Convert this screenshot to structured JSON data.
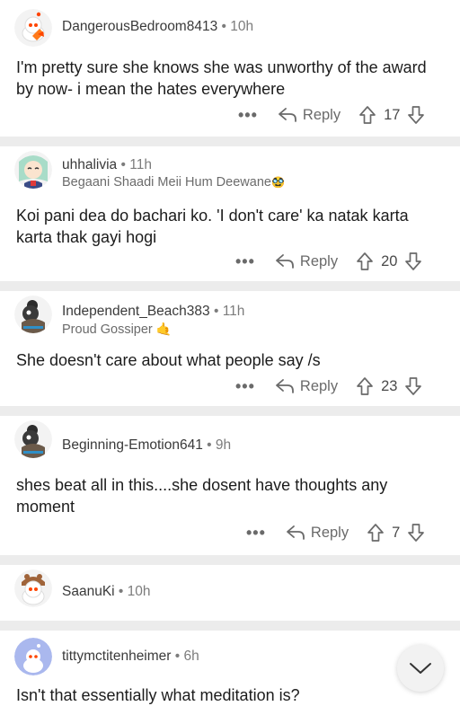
{
  "comments": [
    {
      "username": "DangerousBedroom8413",
      "time": "10h",
      "body": "I'm pretty sure she knows she was unworthy of the award by now- i mean the hates everywhere",
      "reply_label": "Reply",
      "votes": "17",
      "more_label": "•••"
    },
    {
      "username": "uhhalivia",
      "time": "11h",
      "flair": "Begaani Shaadi Meii Hum Deewane",
      "flair_emoji": "🥸",
      "body": "Koi pani dea do bachari ko. 'I don't care' ka natak karta karta thak gayi hogi",
      "reply_label": "Reply",
      "votes": "20",
      "more_label": "•••"
    },
    {
      "username": "Independent_Beach383",
      "time": "11h",
      "flair": "Proud Gossiper",
      "flair_emoji": "🤙",
      "body": "She doesn't care about what people say  /s",
      "reply_label": "Reply",
      "votes": "23",
      "more_label": "•••"
    },
    {
      "username": "Beginning-Emotion641",
      "time": "9h",
      "body": "shes beat all in this....she dosent have thoughts any moment",
      "reply_label": "Reply",
      "votes": "7",
      "more_label": "•••"
    },
    {
      "username": "SaanuKi",
      "time": "10h"
    },
    {
      "username": "tittymctitenheimer",
      "time": "6h",
      "body": "Isn't that essentially what meditation is?"
    }
  ],
  "dot": "•",
  "colors": {
    "upvote_icon": "#6a6a6a",
    "separator": "#ececec",
    "snoo_orange": "#ff4500"
  },
  "icons": {
    "reply": "reply-arrow-icon",
    "upvote": "upvote-arrow-icon",
    "downvote": "downvote-arrow-icon",
    "collapse": "chevron-down-icon"
  }
}
